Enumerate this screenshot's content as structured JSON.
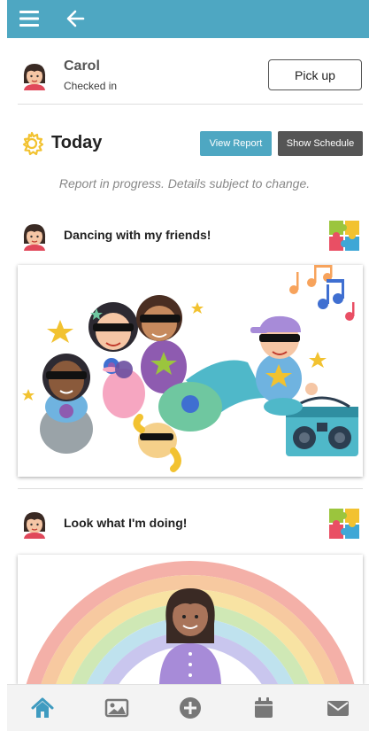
{
  "child": {
    "name": "Carol",
    "status": "Checked in",
    "pickup_label": "Pick up"
  },
  "today": {
    "title": "Today",
    "view_report_label": "View Report",
    "show_schedule_label": "Show Schedule",
    "note": "Report in progress. Details subject to change."
  },
  "posts": [
    {
      "title": "Dancing with my friends!"
    },
    {
      "title": "Look what I'm doing!"
    }
  ],
  "nav": {
    "items": [
      "home-icon",
      "gallery-icon",
      "add-icon",
      "calendar-icon",
      "mail-icon"
    ],
    "active": "home-icon"
  },
  "colors": {
    "header": "#4ea7c2",
    "accent": "#4ea7c2",
    "dark_button": "#555555",
    "icon_inactive": "#777777",
    "gear": "#f2c230"
  }
}
